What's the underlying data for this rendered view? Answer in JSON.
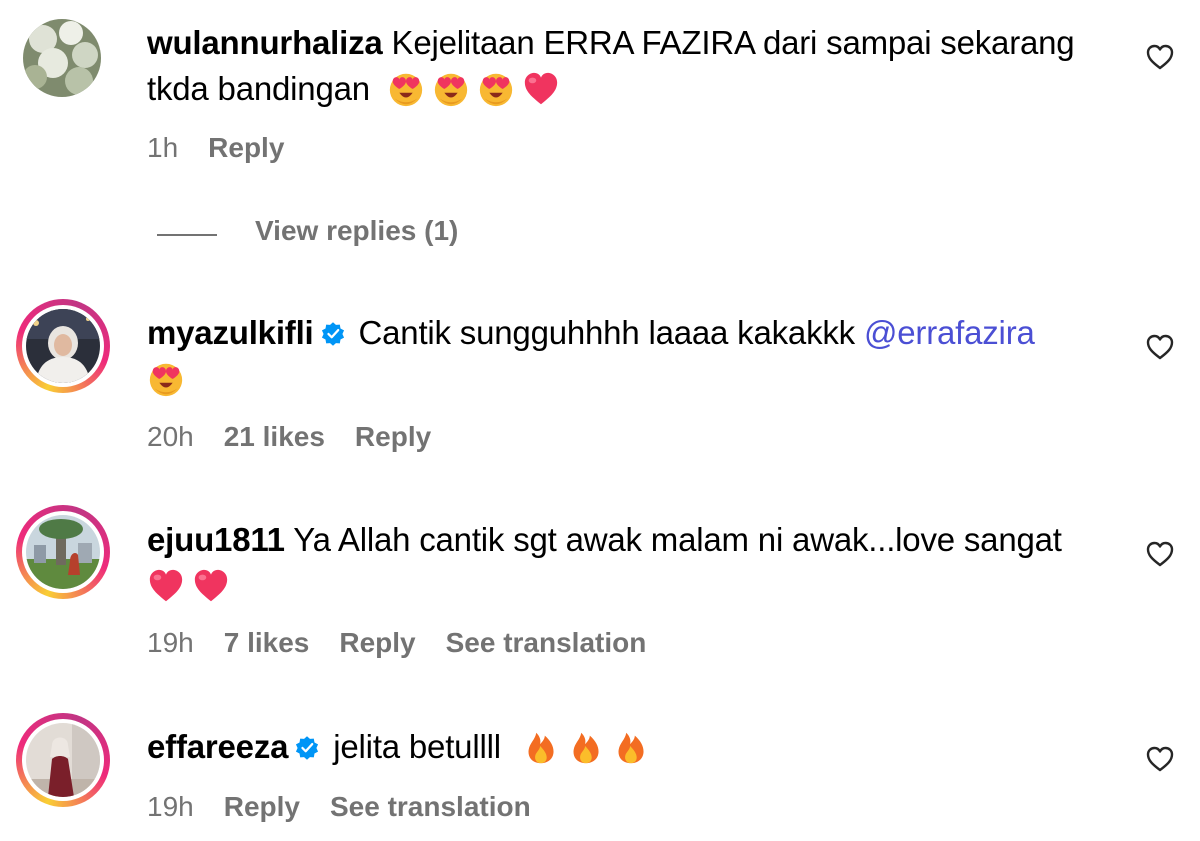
{
  "comments": [
    {
      "username": "wulannurhaliza",
      "verified": false,
      "text_line1": "Kejelitaan ERRA FAZIRA dari sampai sekarang",
      "text_line2": "tkda bandingan",
      "time": "1h",
      "likes": "",
      "reply": "Reply",
      "emojis": [
        "heart-eyes-emoji",
        "heart-eyes-emoji",
        "heart-eyes-emoji",
        "red-heart-emoji"
      ],
      "view_replies": "View replies (1)"
    },
    {
      "username": "myazulkifli",
      "verified": true,
      "text": "Cantik sungguhhhh laaaa kakakkk",
      "mention": "@errafazira",
      "time": "20h",
      "likes": "21 likes",
      "reply": "Reply",
      "emojis": [
        "heart-eyes-emoji"
      ]
    },
    {
      "username": "ejuu1811",
      "verified": false,
      "text": "Ya Allah cantik sgt awak malam ni awak...love sangat",
      "time": "19h",
      "likes": "7 likes",
      "reply": "Reply",
      "see_translation": "See translation",
      "emojis": [
        "red-heart-emoji",
        "red-heart-emoji"
      ]
    },
    {
      "username": "effareeza",
      "verified": true,
      "text": "jelita betullll",
      "time": "19h",
      "reply": "Reply",
      "see_translation": "See translation",
      "emojis": [
        "fire-emoji",
        "fire-emoji",
        "fire-emoji"
      ]
    }
  ],
  "colors": {
    "secondary_text": "#737373",
    "mention": "#4b4fd4",
    "verified_badge": "#0095f6",
    "heart_emoji": "#f0345f"
  }
}
